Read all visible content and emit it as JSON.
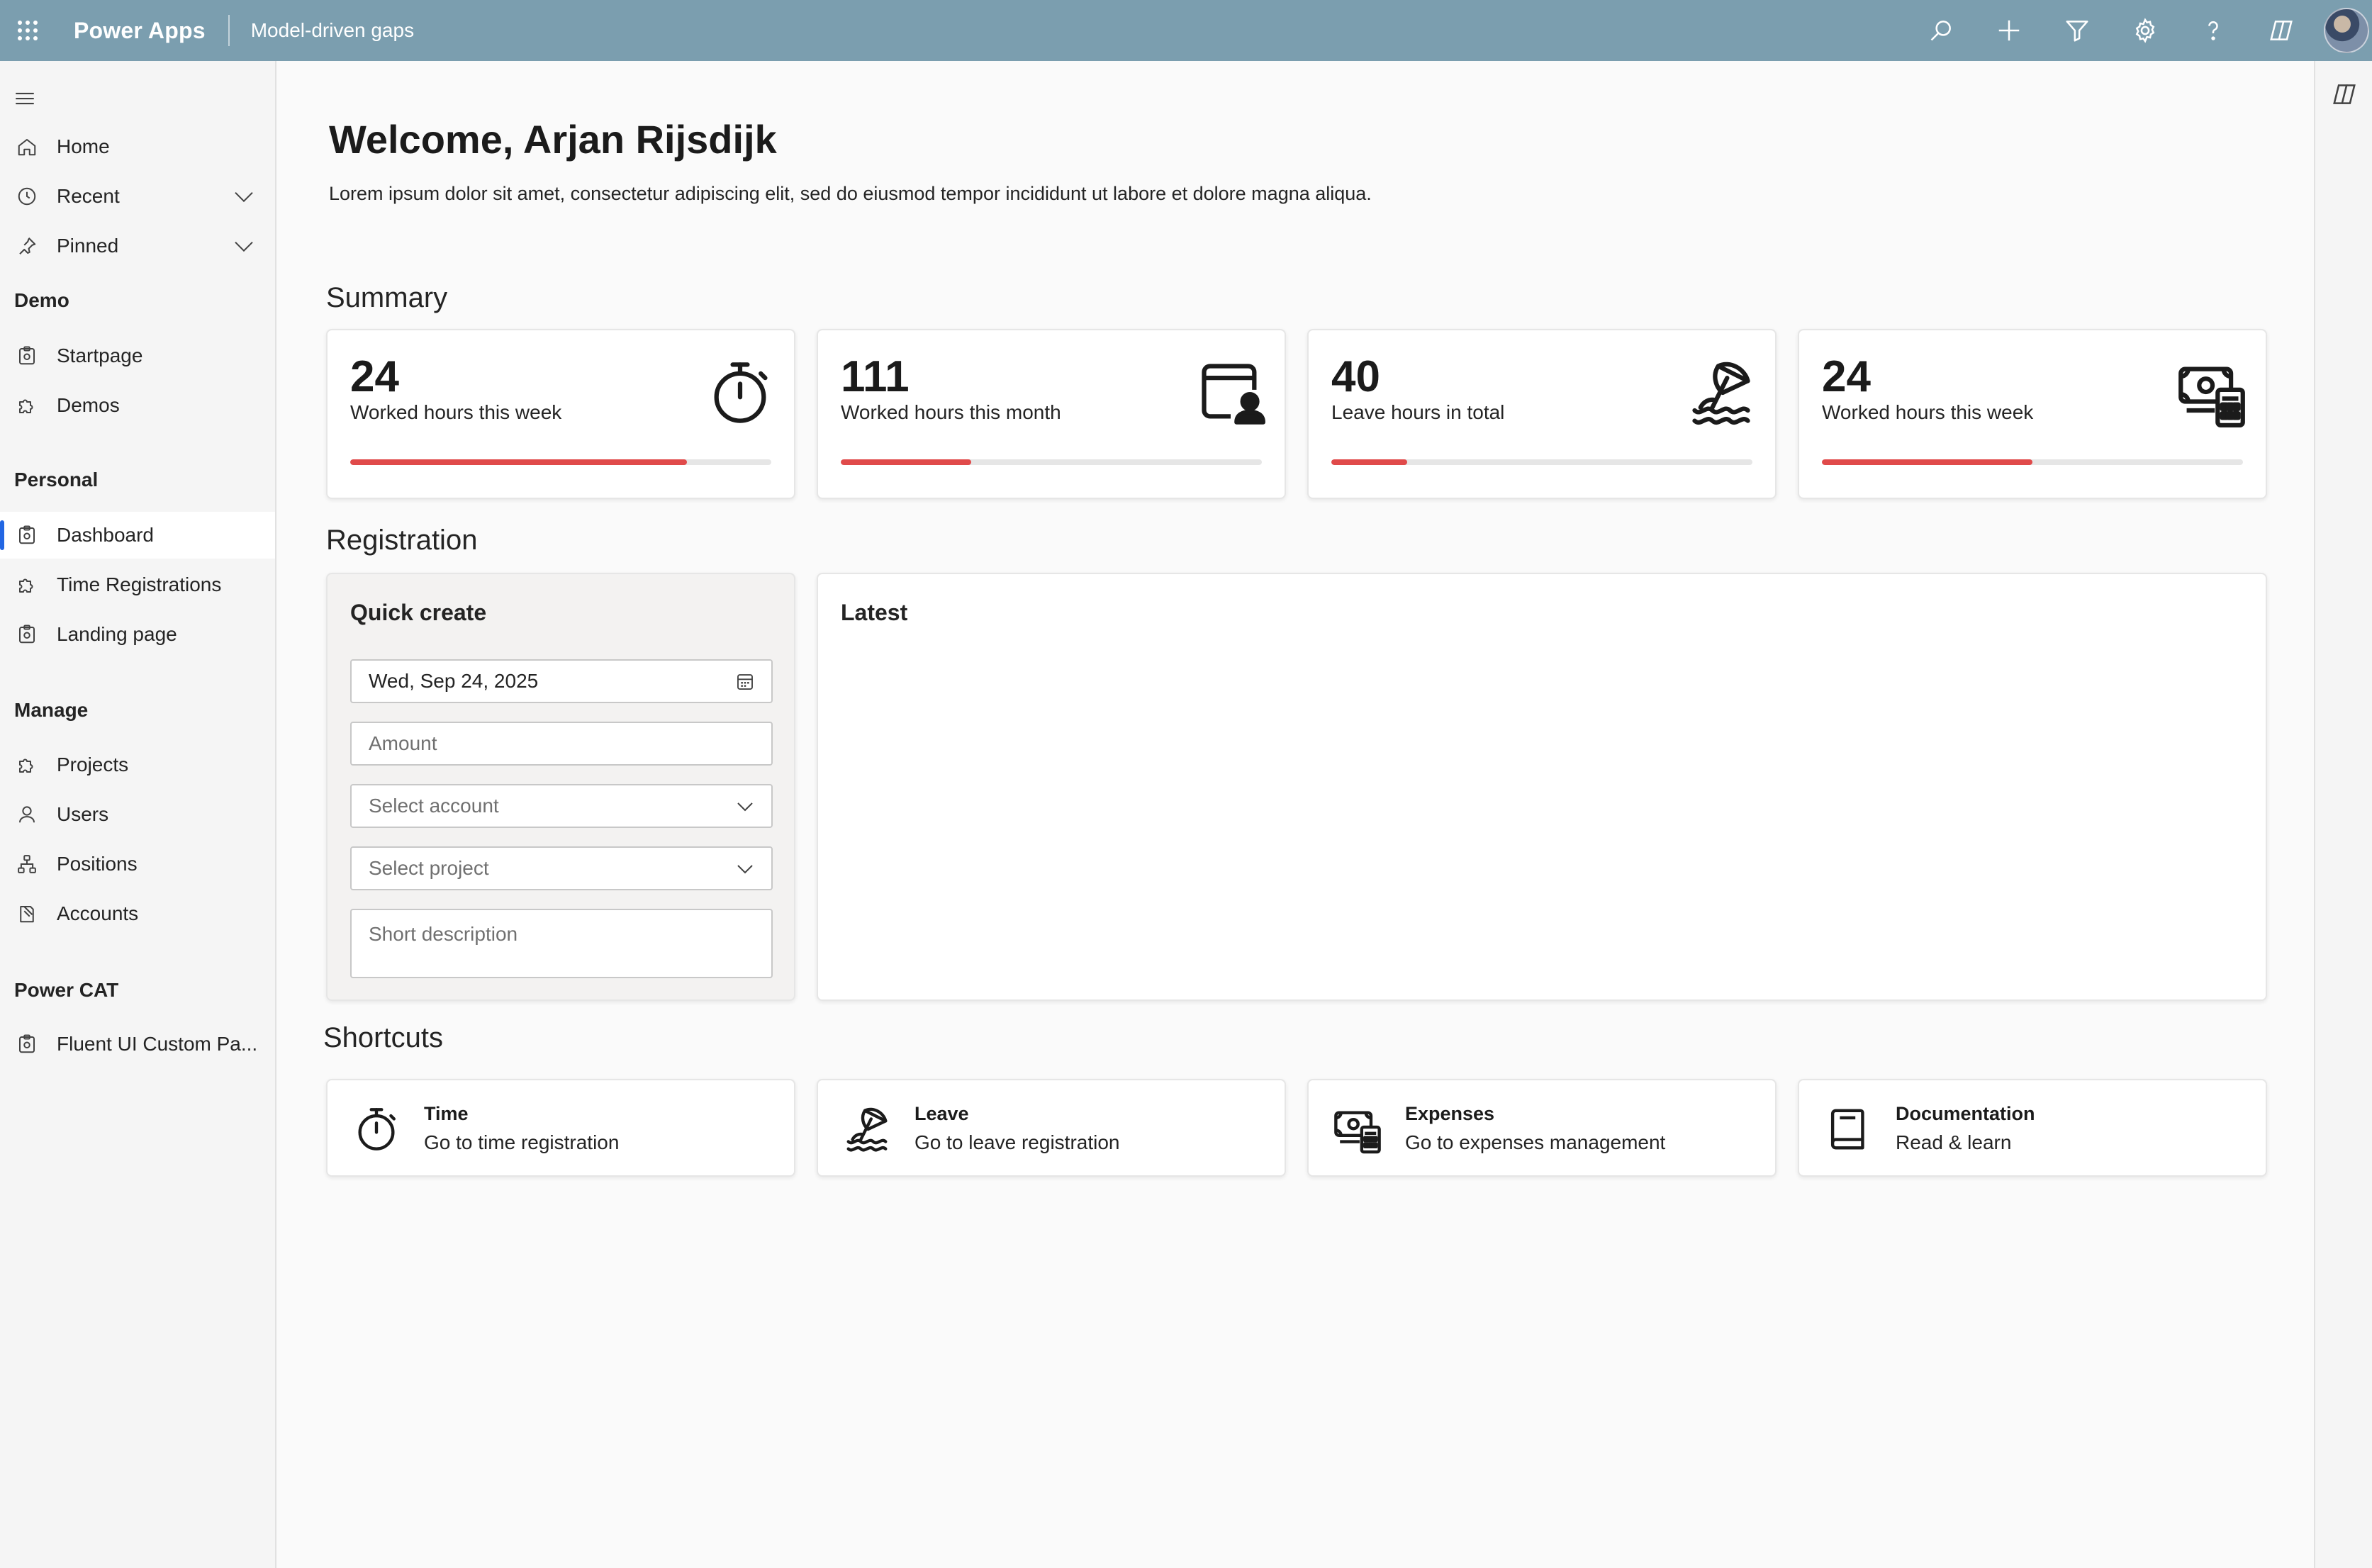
{
  "topbar": {
    "app_name": "Power Apps",
    "environment": "Model-driven gaps",
    "actions": [
      "search-icon",
      "add-icon",
      "filter-icon",
      "settings-icon",
      "help-icon",
      "copilot-icon"
    ]
  },
  "nav": {
    "items_top": [
      {
        "label": "Home",
        "icon": "home-icon"
      },
      {
        "label": "Recent",
        "icon": "clock-icon",
        "expandable": true
      },
      {
        "label": "Pinned",
        "icon": "pin-icon",
        "expandable": true
      }
    ],
    "sections": [
      {
        "title": "Demo",
        "items": [
          {
            "label": "Startpage",
            "icon": "page-icon"
          },
          {
            "label": "Demos",
            "icon": "puzzle-icon"
          }
        ]
      },
      {
        "title": "Personal",
        "items": [
          {
            "label": "Dashboard",
            "icon": "page-icon",
            "active": true
          },
          {
            "label": "Time Registrations",
            "icon": "puzzle-icon"
          },
          {
            "label": "Landing page",
            "icon": "page-icon"
          }
        ]
      },
      {
        "title": "Manage",
        "items": [
          {
            "label": "Projects",
            "icon": "puzzle-icon"
          },
          {
            "label": "Users",
            "icon": "person-icon"
          },
          {
            "label": "Positions",
            "icon": "org-chart-icon"
          },
          {
            "label": "Accounts",
            "icon": "book-icon"
          }
        ]
      },
      {
        "title": "Power CAT",
        "items": [
          {
            "label": "Fluent UI Custom Pa...",
            "icon": "page-icon"
          }
        ]
      }
    ]
  },
  "main": {
    "welcome": "Welcome, Arjan Rijsdijk",
    "intro": "Lorem ipsum dolor sit amet, consectetur adipiscing elit, sed do eiusmod tempor incididunt ut labore et dolore magna aliqua.",
    "summary_title": "Summary",
    "summary": [
      {
        "value": "24",
        "label": "Worked hours this week",
        "icon": "stopwatch-icon",
        "progress": 0.8
      },
      {
        "value": "111",
        "label": "Worked hours this month",
        "icon": "calendar-person-icon",
        "progress": 0.31
      },
      {
        "value": "40",
        "label": "Leave hours in total",
        "icon": "beach-umbrella-icon",
        "progress": 0.18
      },
      {
        "value": "24",
        "label": "Worked hours this week",
        "icon": "money-calculator-icon",
        "progress": 0.5
      }
    ],
    "registration_title": "Registration",
    "quick_create": {
      "title": "Quick create",
      "date_value": "Wed, Sep 24, 2025",
      "amount_placeholder": "Amount",
      "account_placeholder": "Select account",
      "project_placeholder": "Select project",
      "description_placeholder": "Short description"
    },
    "latest_title": "Latest",
    "shortcuts_title": "Shortcuts",
    "shortcuts": [
      {
        "title": "Time",
        "subtitle": "Go to time registration",
        "icon": "stopwatch-icon"
      },
      {
        "title": "Leave",
        "subtitle": "Go to leave registration",
        "icon": "beach-umbrella-icon"
      },
      {
        "title": "Expenses",
        "subtitle": "Go to expenses management",
        "icon": "money-calculator-icon"
      },
      {
        "title": "Documentation",
        "subtitle": "Read & learn",
        "icon": "book-icon"
      }
    ]
  },
  "colors": {
    "topbar": "#7b9eaf",
    "progress": "#e04a4a",
    "active_indicator": "#2266e3"
  }
}
